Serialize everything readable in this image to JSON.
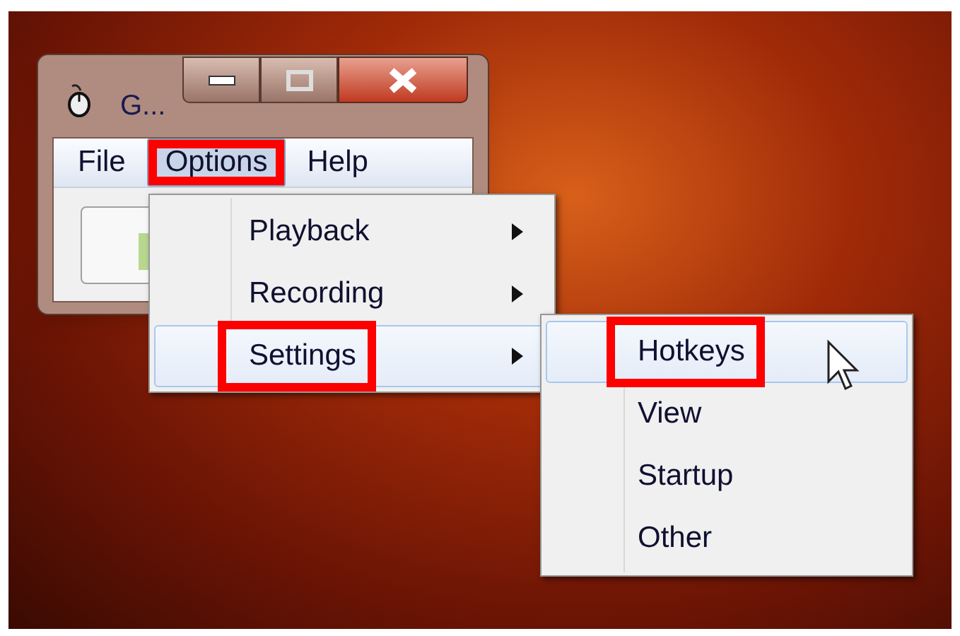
{
  "window": {
    "title": "G..."
  },
  "menu_bar": [
    {
      "label": "File",
      "selected": false,
      "annotated": false
    },
    {
      "label": "Options",
      "selected": true,
      "annotated": true
    },
    {
      "label": "Help",
      "selected": false,
      "annotated": false
    }
  ],
  "options_menu": [
    {
      "label": "Playback",
      "selected": false,
      "has_submenu": true,
      "annotated": false
    },
    {
      "label": "Recording",
      "selected": false,
      "has_submenu": true,
      "annotated": false
    },
    {
      "label": "Settings",
      "selected": true,
      "has_submenu": true,
      "annotated": true
    }
  ],
  "settings_submenu": [
    {
      "label": "Hotkeys",
      "selected": true,
      "annotated": true
    },
    {
      "label": "View",
      "selected": false,
      "annotated": false
    },
    {
      "label": "Startup",
      "selected": false,
      "annotated": false
    },
    {
      "label": "Other",
      "selected": false,
      "annotated": false
    }
  ]
}
